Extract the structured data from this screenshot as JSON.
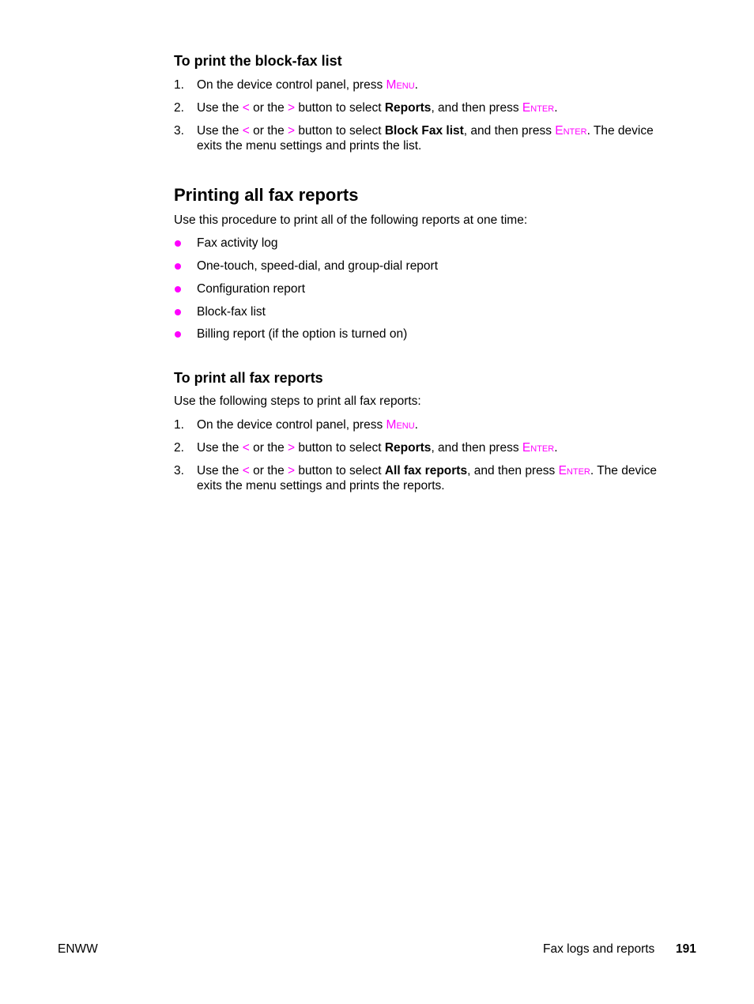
{
  "section1": {
    "heading": "To print the block-fax list",
    "steps": [
      {
        "num": "1.",
        "pre": "On the device control panel, press ",
        "kw": "Menu",
        "post": "."
      },
      {
        "num": "2.",
        "a": "Use the ",
        "lt": "<",
        "b": " or the ",
        "gt": ">",
        "c": " button to select ",
        "bold": "Reports",
        "d": ", and then press ",
        "kw": "Enter",
        "e": "."
      },
      {
        "num": "3.",
        "a": "Use the ",
        "lt": "<",
        "b": " or the ",
        "gt": ">",
        "c": " button to select ",
        "bold": "Block Fax list",
        "d": ", and then press ",
        "kw": "Enter",
        "e": ". The device exits the menu settings and prints the list."
      }
    ]
  },
  "section2": {
    "heading": "Printing all fax reports",
    "intro": "Use this procedure to print all of the following reports at one time:",
    "bullets": [
      "Fax activity log",
      "One-touch, speed-dial, and group-dial report",
      "Configuration report",
      "Block-fax list",
      "Billing report (if the option is turned on)"
    ]
  },
  "section3": {
    "heading": "To print all fax reports",
    "intro": "Use the following steps to print all fax reports:",
    "steps": [
      {
        "num": "1.",
        "pre": "On the device control panel, press ",
        "kw": "Menu",
        "post": "."
      },
      {
        "num": "2.",
        "a": "Use the ",
        "lt": "<",
        "b": " or the ",
        "gt": ">",
        "c": " button to select ",
        "bold": "Reports",
        "d": ", and then press ",
        "kw": "Enter",
        "e": "."
      },
      {
        "num": "3.",
        "a": "Use the ",
        "lt": "<",
        "b": " or the ",
        "gt": ">",
        "c": " button to select ",
        "bold": "All fax reports",
        "d": ", and then press ",
        "kw": "Enter",
        "e": ". The device exits the menu settings and prints the reports."
      }
    ]
  },
  "footer": {
    "left": "ENWW",
    "section": "Fax logs and reports",
    "page": "191"
  },
  "colors": {
    "accent": "#ff00ff",
    "text": "#000000"
  }
}
